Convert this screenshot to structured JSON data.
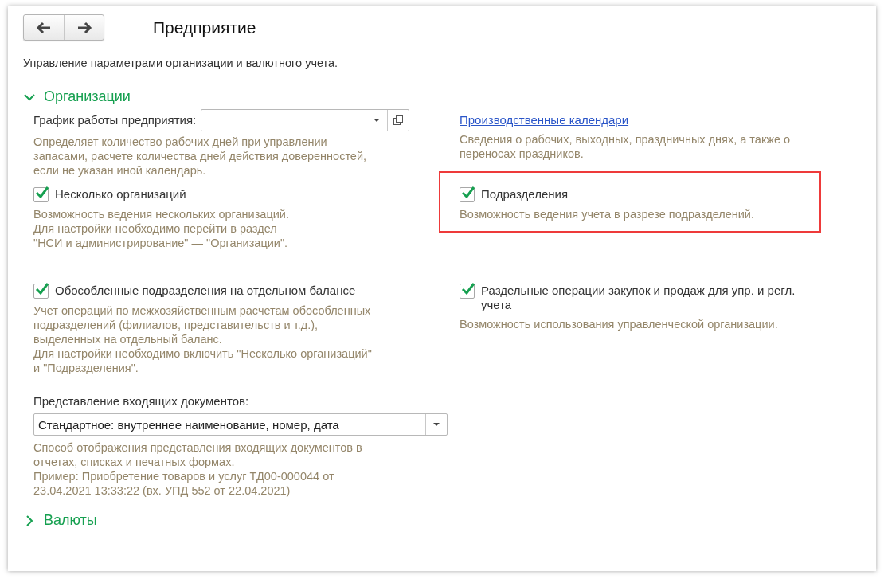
{
  "title": "Предприятие",
  "description": "Управление параметрами организации и валютного учета.",
  "sections": [
    {
      "title": "Организации",
      "expanded": true,
      "rows": [
        {
          "left": {
            "kind": "field",
            "label": "График работы предприятия:",
            "hint": "Определяет количество рабочих дней при управлении\nзапасами, расчете количества дней действия доверенностей,\nесли не указан иной календарь."
          },
          "right": {
            "kind": "link",
            "label": "Производственные календари",
            "hint": "Сведения о рабочих, выходных, праздничных днях, а также о\nпереносах праздников."
          }
        },
        {
          "left": {
            "kind": "checkbox",
            "label": "Несколько организаций",
            "checked": true,
            "highlighted": false,
            "hint": "Возможность ведения нескольких организаций.\nДля настройки необходимо перейти в раздел\n\"НСИ и администрирование\" — \"Организации\"."
          },
          "right": {
            "kind": "checkbox",
            "label": "Подразделения",
            "checked": true,
            "highlighted": true,
            "hint": "Возможность ведения учета в разрезе подразделений."
          }
        },
        {
          "left": {
            "kind": "checkbox",
            "label": "Обособленные подразделения на отдельном балансе",
            "checked": true,
            "highlighted": false,
            "hint": "Учет операций по межхозяйственным расчетам обособленных\nподразделений (филиалов, представительств и т.д.),\nвыделенных на отдельный баланс.\nДля настройки необходимо включить \"Несколько организаций\"\nи \"Подразделения\"."
          },
          "right": {
            "kind": "checkbox",
            "label": "Раздельные операции закупок и продаж для упр. и регл.\nучета",
            "checked": true,
            "highlighted": false,
            "hint": "Возможность использования управленческой организации."
          }
        },
        {
          "left": {
            "kind": "dropdown",
            "label": "Представление входящих документов:",
            "value": "Стандартное: внутреннее наименование, номер, дата",
            "hint": "Способ отображения представления входящих документов в\nотчетах, списках и печатных формах.\nПример: Приобретение товаров и услуг ТД00-000044 от\n23.04.2021 13:33:22 (вх. УПД 552 от 22.04.2021)"
          }
        }
      ]
    },
    {
      "title": "Валюты",
      "expanded": false
    }
  ]
}
